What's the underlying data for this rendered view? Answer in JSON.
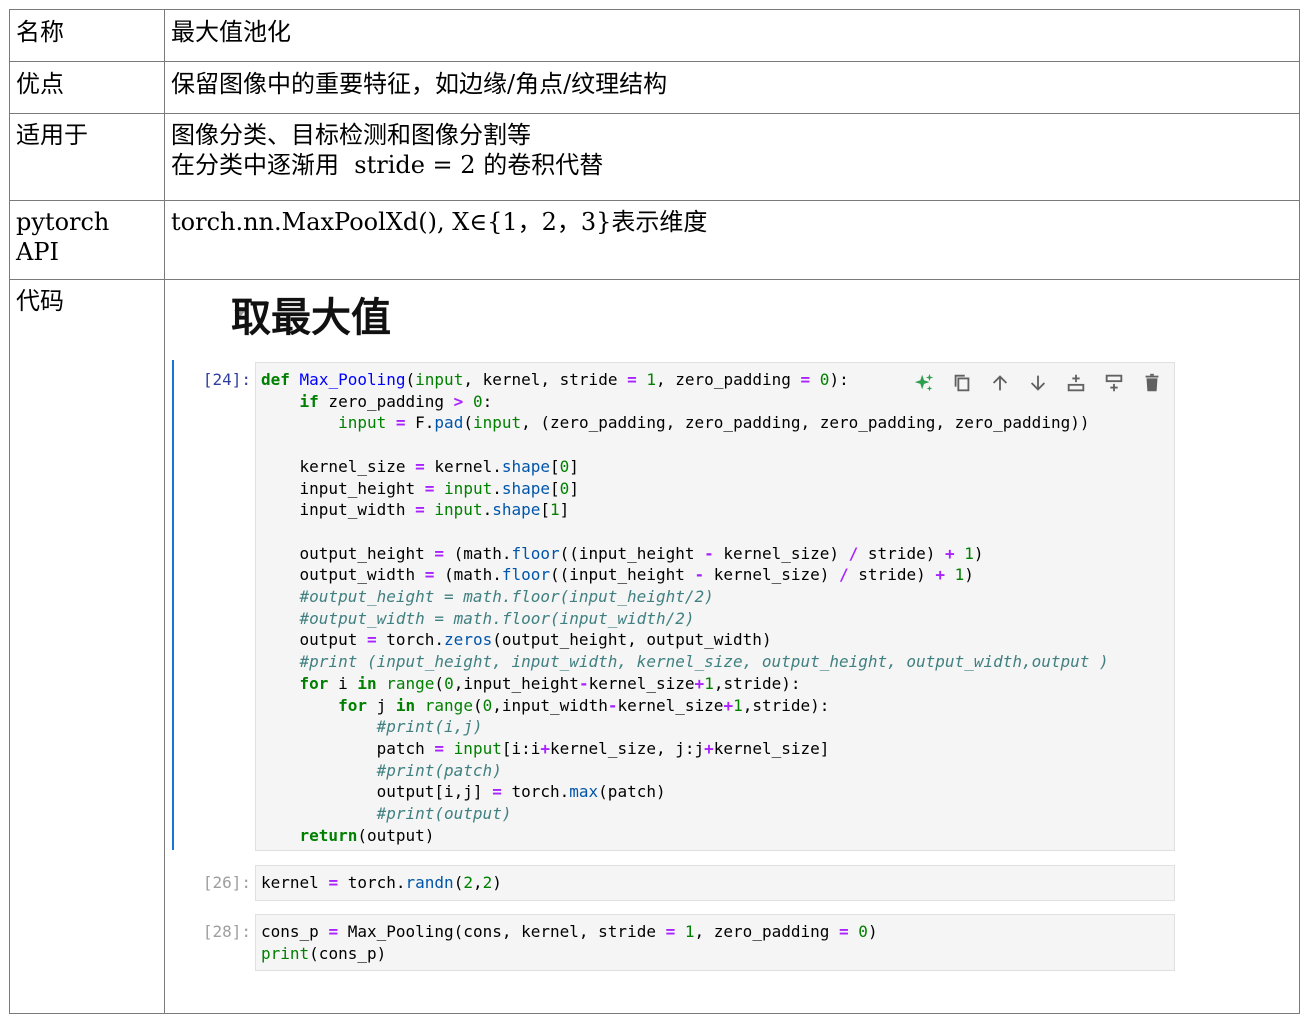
{
  "rows": [
    {
      "label": "名称",
      "value": "最大值池化"
    },
    {
      "label": "优点",
      "value": "保留图像中的重要特征，如边缘/角点/纹理结构"
    },
    {
      "label": "适用于",
      "value_lines": [
        "图像分类、目标检测和图像分割等",
        "在分类中逐渐用  stride = 2 的卷积代替"
      ]
    },
    {
      "label": "pytorch API",
      "value": "torch.nn.MaxPoolXd(), X∈{1，2，3}表示维度"
    },
    {
      "label": "代码"
    }
  ],
  "notebook": {
    "heading": "取最大值",
    "cells": [
      {
        "prompt": "[24]:",
        "active": true
      },
      {
        "prompt": "[26]:",
        "active": false
      },
      {
        "prompt": "[28]:",
        "active": false
      }
    ],
    "toolbar_icons": [
      "sparkle-icon",
      "copy-icon",
      "arrow-up-icon",
      "arrow-down-icon",
      "insert-above-icon",
      "insert-below-icon",
      "delete-icon"
    ],
    "colors": {
      "accent": "#1976d2",
      "prompt_active": "#303f9f",
      "prompt_inactive": "#9e9e9e",
      "keyword": "#008000",
      "comment": "#408080",
      "operator": "#aa22ff"
    }
  }
}
